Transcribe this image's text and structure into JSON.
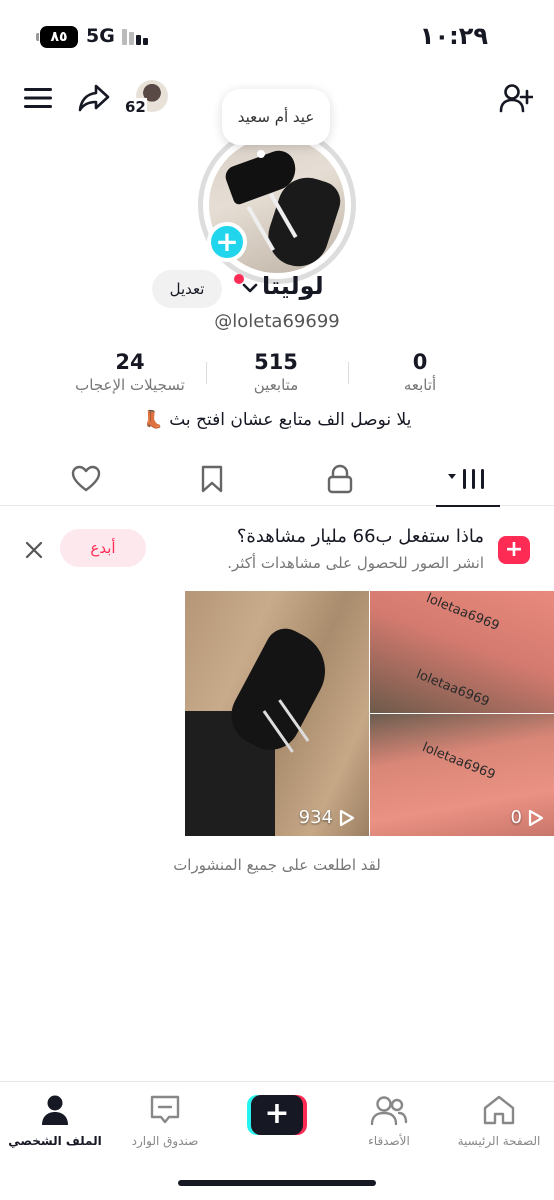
{
  "status_bar": {
    "battery": "٨٥",
    "network": "5G",
    "time": "١٠:٢٩"
  },
  "top_bar": {
    "friends_count": "62"
  },
  "profile": {
    "note_bubble": "عيد أم سعيد",
    "display_name": "لوليتا",
    "edit_label": "تعديل",
    "handle": "@loleta69699",
    "stats": {
      "following_count": "0",
      "following_label": "أتابعه",
      "followers_count": "515",
      "followers_label": "متابعين",
      "likes_count": "24",
      "likes_label": "تسجيلات الإعجاب"
    },
    "bio": "يلا نوصل الف متابع عشان افتح بث 👢"
  },
  "tabs": [
    {
      "name": "videos",
      "icon": "grid-icon",
      "active": true
    },
    {
      "name": "private",
      "icon": "lock-icon",
      "active": false
    },
    {
      "name": "favorites",
      "icon": "bookmark-icon",
      "active": false
    },
    {
      "name": "liked",
      "icon": "heart-icon",
      "active": false
    }
  ],
  "promo": {
    "title": "ماذا ستفعل ب66 مليار مشاهدة؟",
    "subtitle": "انشر الصور للحصول على مشاهدات أكثر.",
    "create_label": "أبدع"
  },
  "posts": [
    {
      "views": "934",
      "watermark": ""
    },
    {
      "views": "0",
      "watermark": "loletaa6969"
    }
  ],
  "watermarks": [
    "loletaa6969",
    "loletaa6969",
    "loletaa6969"
  ],
  "all_seen": "لقد اطلعت على جميع المنشورات",
  "bottom_nav": {
    "home": "الصفحة الرئيسية",
    "friends": "الأصدقاء",
    "inbox": "صندوق الوارد",
    "profile": "الملف الشخصي"
  },
  "colors": {
    "accent_pink": "#fe2c55",
    "accent_cyan": "#25f4ee",
    "text": "#161823"
  }
}
